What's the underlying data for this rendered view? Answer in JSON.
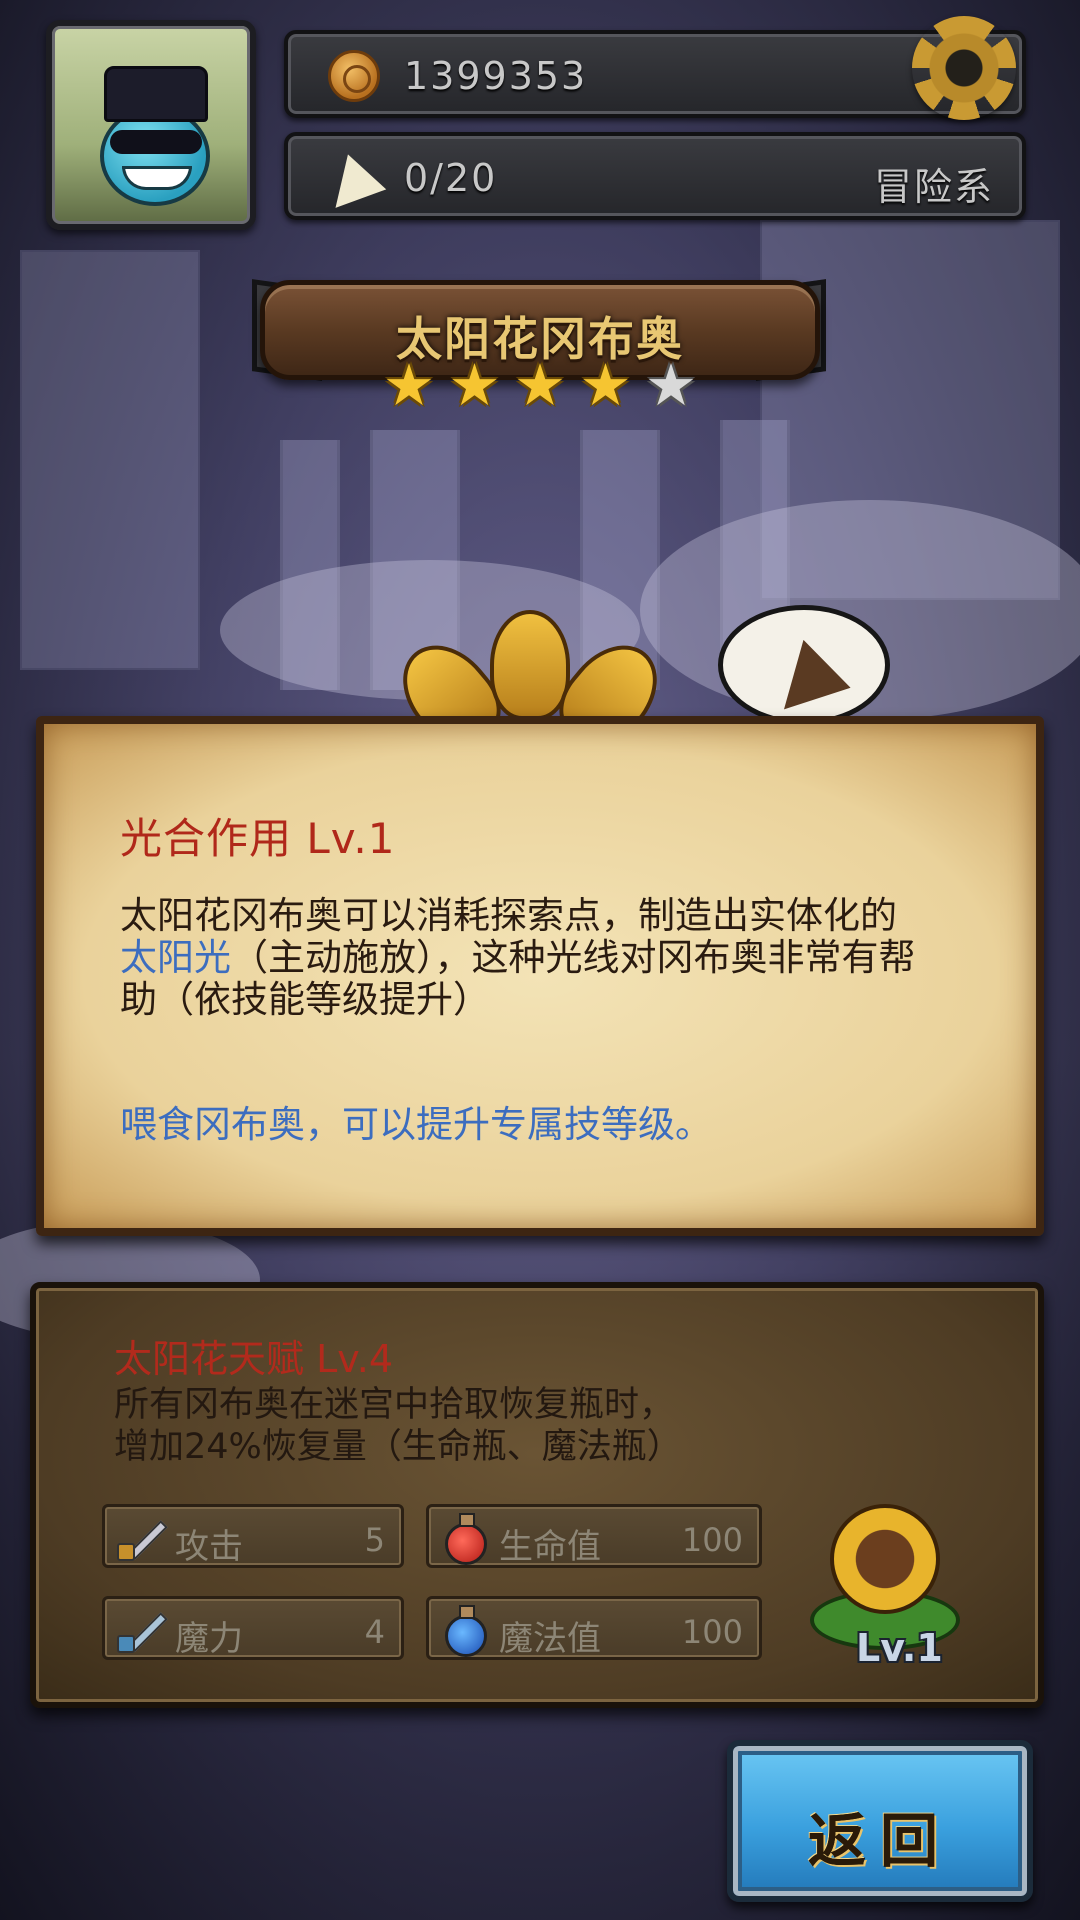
{
  "hud": {
    "coins": "1399353",
    "food_count": "0/20",
    "element_type": "冒险系"
  },
  "hero": {
    "name": "太阳花冈布奥",
    "stars_filled": 4,
    "stars_total": 5
  },
  "skill": {
    "title": "光合作用 Lv.1",
    "desc_part1": "太阳花冈布奥可以消耗探索点，制造出实体化的",
    "desc_highlight": "太阳光",
    "desc_part2": "（主动施放），这种光线对冈布奥非常有帮助（依技能等级提升）",
    "feed_hint": "喂食冈布奥，可以提升专属技等级。"
  },
  "talent": {
    "title": "太阳花天赋 Lv.4",
    "desc_line1": "所有冈布奥在迷宫中拾取恢复瓶时，",
    "desc_line2": "增加24%恢复量（生命瓶、魔法瓶）",
    "stats": {
      "attack": {
        "label": "攻击",
        "value": "5"
      },
      "hp": {
        "label": "生命值",
        "value": "100"
      },
      "magic": {
        "label": "魔力",
        "value": "4"
      },
      "mp": {
        "label": "魔法值",
        "value": "100"
      }
    },
    "pet_level": "Lv.1"
  },
  "buttons": {
    "back_label": "返回"
  },
  "icons": {
    "coin": "coin-icon",
    "food": "cake-icon",
    "settings": "gear-icon",
    "attack": "sword-icon",
    "hp": "red-potion-icon",
    "magic": "wand-icon",
    "mp": "blue-potion-icon"
  },
  "colors": {
    "skill_title": "#b0281a",
    "highlight_blue": "#3c6dbf",
    "star_gold": "#f6c531",
    "button_blue": "#3aa0de"
  }
}
